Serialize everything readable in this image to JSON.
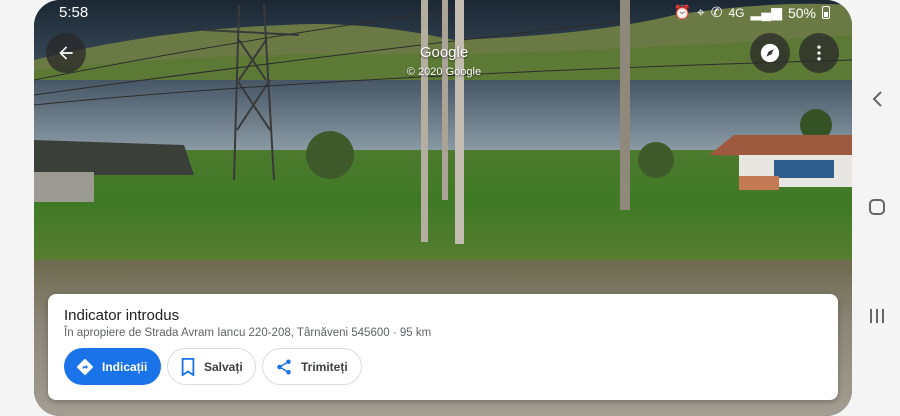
{
  "status_bar": {
    "time": "5:58",
    "network": "4G",
    "battery": "50%"
  },
  "street_view": {
    "brand": "Google",
    "copyright": "© 2020 Google"
  },
  "place_card": {
    "title": "Indicator introdus",
    "subtitle": "În apropiere de Strada Avram Iancu 220-208, Târnăveni 545600 · 95 km",
    "actions": [
      {
        "label": "Indicații",
        "icon": "directions-icon"
      },
      {
        "label": "Salvați",
        "icon": "bookmark-icon"
      },
      {
        "label": "Trimiteți",
        "icon": "share-icon"
      }
    ]
  },
  "colors": {
    "primary": "#1a73e8",
    "card_bg": "#ffffff",
    "text_primary": "#202124",
    "text_secondary": "#5f6368"
  }
}
